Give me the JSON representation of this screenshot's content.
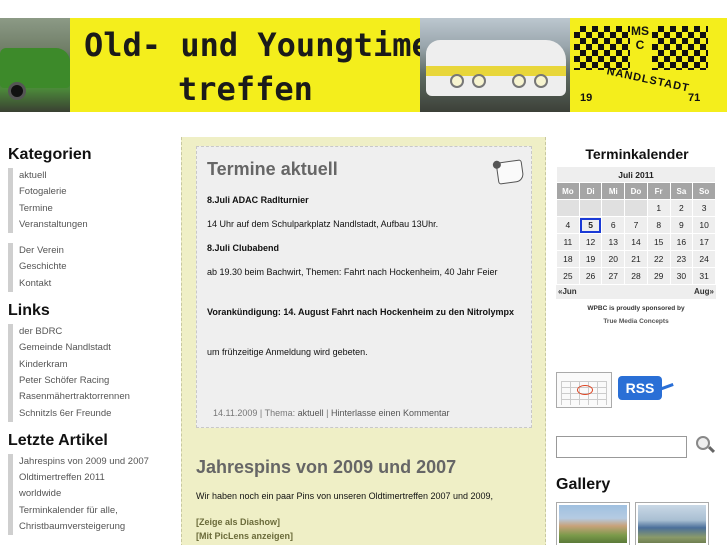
{
  "header": {
    "title_line1": "Old- und Youngtimer-",
    "title_line2": "treffen",
    "logo": {
      "abbr_line1": "MS",
      "abbr_line2": "C",
      "town": "NANDLSTADT",
      "year_left": "19",
      "year_right": "71"
    }
  },
  "sidebar": {
    "categories_title": "Kategorien",
    "categories": [
      "aktuell",
      "Fotogalerie",
      "Termine",
      "Veranstaltungen"
    ],
    "pages": [
      "Der Verein",
      "Geschichte",
      "Kontakt"
    ],
    "links_title": "Links",
    "links": [
      "der BDRC",
      "Gemeinde Nandlstadt",
      "Kinderkram",
      "Peter Schöfer Racing",
      "Rasenmähertraktorrennen",
      "Schnitzls 6er Freunde"
    ],
    "recent_title": "Letzte Artikel",
    "recent": [
      "Jahrespins von 2009 und 2007",
      "Oldtimertreffen 2011",
      "worldwide",
      "Terminkalender für alle,",
      "Christbaumversteigerung"
    ]
  },
  "post1": {
    "title": "Termine aktuell",
    "p1": "8.Juli ADAC Radlturnier",
    "p2": "14 Uhr auf dem Schulparkplatz Nandlstadt, Aufbau 13Uhr.",
    "p3": "8.Juli Clubabend",
    "p4": "ab 19.30 beim Bachwirt,  Themen: Fahrt nach Hockenheim, 40 Jahr Feier",
    "p5_label": "Vorankündigung",
    "p5_text": ":  14. August Fahrt nach Hockenheim zu den Nitrolympx",
    "p6": "um frühzeitige Anmeldung wird gebeten.",
    "meta_date": "14.11.2009",
    "meta_sep1": " | Thema: ",
    "meta_category": "aktuell",
    "meta_sep2": " | ",
    "meta_comment": "Hinterlasse einen Kommentar"
  },
  "post2": {
    "title": "Jahrespins von 2009 und 2007",
    "text": "Wir haben noch ein paar Pins von unseren Oldtimertreffen 2007 und 2009,",
    "link1": "[Zeige als Diashow]",
    "link2": "[Mit PicLens anzeigen]"
  },
  "calendar": {
    "title": "Terminkalender",
    "month": "Juli 2011",
    "weekdays": [
      "Mo",
      "Di",
      "Mi",
      "Do",
      "Fr",
      "Sa",
      "So"
    ],
    "weeks": [
      [
        "",
        "",
        "",
        "",
        "1",
        "2",
        "3"
      ],
      [
        "4",
        "5",
        "6",
        "7",
        "8",
        "9",
        "10"
      ],
      [
        "11",
        "12",
        "13",
        "14",
        "15",
        "16",
        "17"
      ],
      [
        "18",
        "19",
        "20",
        "21",
        "22",
        "23",
        "24"
      ],
      [
        "25",
        "26",
        "27",
        "28",
        "29",
        "30",
        "31"
      ]
    ],
    "today": "5",
    "prev": "«Jun",
    "next": "Aug»",
    "sponsor_line": "WPBC is proudly sponsored by",
    "sponsor_name": "True Media Concepts"
  },
  "rss_label": "RSS",
  "search": {
    "value": "",
    "placeholder": ""
  },
  "gallery_title": "Gallery",
  "icons": {
    "note": "note-icon",
    "calendar": "calendar-icon",
    "rss": "rss-icon",
    "search": "magnifier-icon"
  }
}
